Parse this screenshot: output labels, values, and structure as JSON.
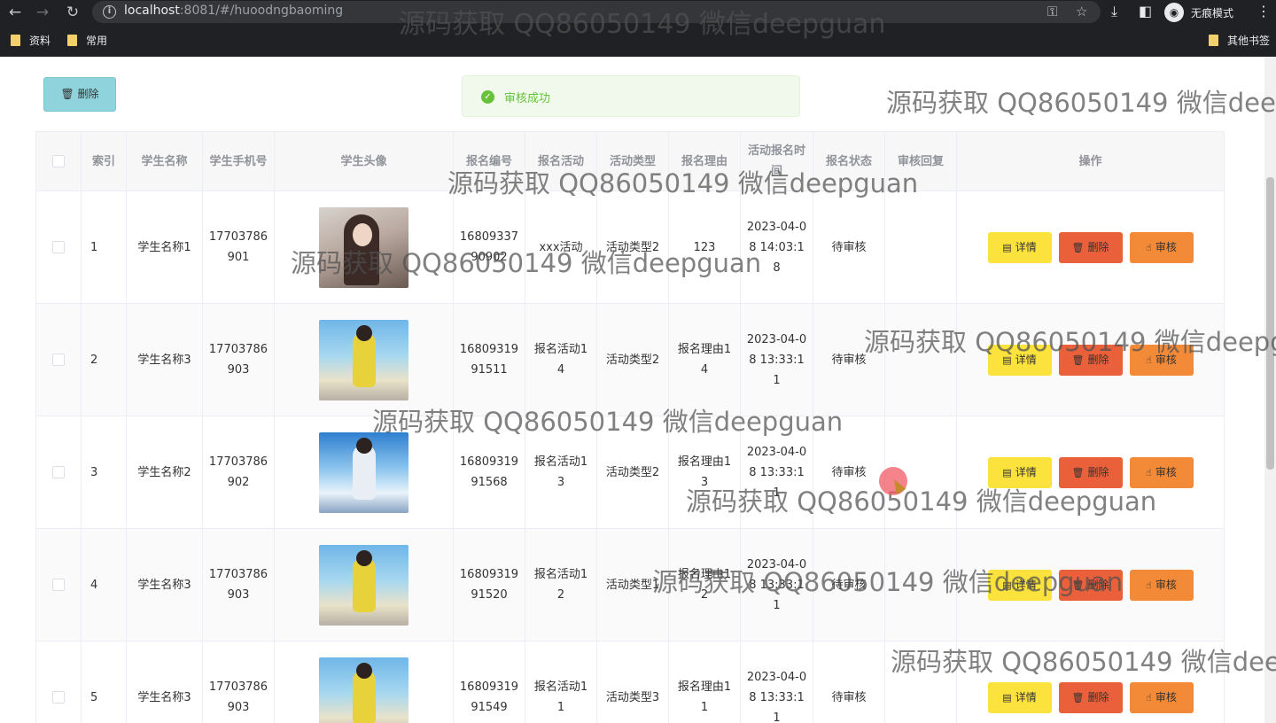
{
  "browser": {
    "url_host": "localhost",
    "url_rest": ":8081/#/huoodngbaoming",
    "incognito_label": "无痕模式",
    "bookmarks": [
      "资料",
      "常用"
    ],
    "other_bookmarks": "其他书签"
  },
  "toolbar": {
    "delete_label": "删除"
  },
  "toast": {
    "message": "审核成功",
    "color": "#67c23a"
  },
  "table": {
    "headers": {
      "index": "索引",
      "name": "学生名称",
      "phone": "学生手机号",
      "avatar": "学生头像",
      "no": "报名编号",
      "activity": "报名活动",
      "type": "活动类型",
      "reason": "报名理由",
      "time": "活动报名时间",
      "status": "报名状态",
      "reply": "审核回复",
      "ops": "操作"
    },
    "rows": [
      {
        "index": "1",
        "name": "学生名称1",
        "phone": "17703786901",
        "avatar": "avatar-woman-portrait",
        "no": "1680933790902",
        "activity": "xxx活动",
        "type": "活动类型2",
        "reason": "123",
        "time": "2023-04-08 14:03:18",
        "status": "待审核",
        "reply": ""
      },
      {
        "index": "2",
        "name": "学生名称3",
        "phone": "17703786903",
        "avatar": "avatar-girl-yellow",
        "no": "1680931991511",
        "activity": "报名活动14",
        "type": "活动类型2",
        "reason": "报名理由14",
        "time": "2023-04-08 13:33:11",
        "status": "待审核",
        "reply": ""
      },
      {
        "index": "3",
        "name": "学生名称2",
        "phone": "17703786902",
        "avatar": "avatar-boy-sky",
        "no": "1680931991568",
        "activity": "报名活动13",
        "type": "活动类型2",
        "reason": "报名理由13",
        "time": "2023-04-08 13:33:11",
        "status": "待审核",
        "reply": ""
      },
      {
        "index": "4",
        "name": "学生名称3",
        "phone": "17703786903",
        "avatar": "avatar-girl-yellow",
        "no": "1680931991520",
        "activity": "报名活动12",
        "type": "活动类型1",
        "reason": "报名理由12",
        "time": "2023-04-08 13:33:11",
        "status": "待审核",
        "reply": ""
      },
      {
        "index": "5",
        "name": "学生名称3",
        "phone": "17703786903",
        "avatar": "avatar-girl-yellow",
        "no": "1680931991549",
        "activity": "报名活动11",
        "type": "活动类型3",
        "reason": "报名理由11",
        "time": "2023-04-08 13:33:11",
        "status": "待审核",
        "reply": ""
      }
    ],
    "op_labels": {
      "detail": "详情",
      "delete": "删除",
      "audit": "审核"
    }
  },
  "watermark": "源码获取 QQ86050149 微信deepguan",
  "colors": {
    "detail": "#fbe23c",
    "delete": "#e9603b",
    "audit": "#f28a38",
    "top_delete": "#8fd3dc"
  }
}
